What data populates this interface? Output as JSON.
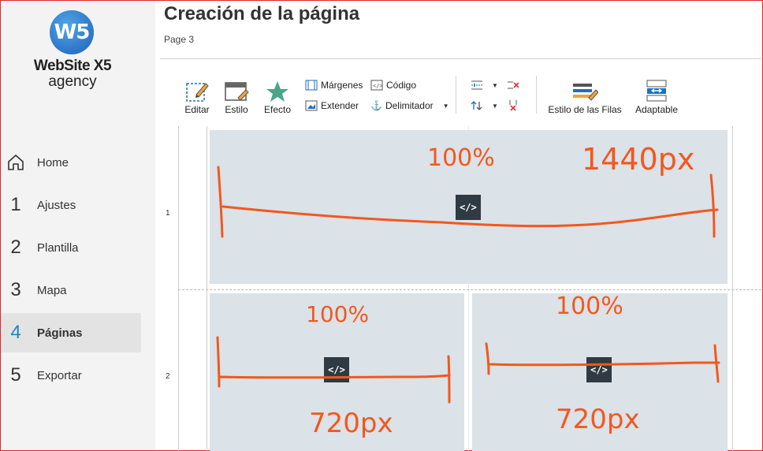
{
  "app": {
    "logo_mark": "W5",
    "logo_name": "WebSite X5",
    "logo_sub": "agency"
  },
  "nav": [
    {
      "num": "",
      "label": "Home",
      "icon": "home-icon"
    },
    {
      "num": "1",
      "label": "Ajustes"
    },
    {
      "num": "2",
      "label": "Plantilla"
    },
    {
      "num": "3",
      "label": "Mapa"
    },
    {
      "num": "4",
      "label": "Páginas",
      "active": true
    },
    {
      "num": "5",
      "label": "Exportar"
    }
  ],
  "header": {
    "title": "Creación de la página",
    "subtitle": "Page 3"
  },
  "toolbar": {
    "edit": "Editar",
    "style": "Estilo",
    "effect": "Efecto",
    "margins": "Márgenes",
    "extend": "Extender",
    "code": "Código",
    "anchor": "Delimitador",
    "row_style": "Estilo de las Filas",
    "adaptive": "Adaptable"
  },
  "grid": {
    "rows": [
      "1",
      "2"
    ],
    "code_glyph": "</>"
  },
  "annotations": {
    "row1_left": "100%",
    "row1_right": "1440px",
    "row2_left_top": "100%",
    "row2_left_bottom": "720px",
    "row2_right_top": "100%",
    "row2_right_bottom": "720px"
  },
  "colors": {
    "accent": "#1a86c8",
    "annotation": "#f2581e",
    "cell": "#dbe2e8",
    "frame": "#e0252a"
  }
}
